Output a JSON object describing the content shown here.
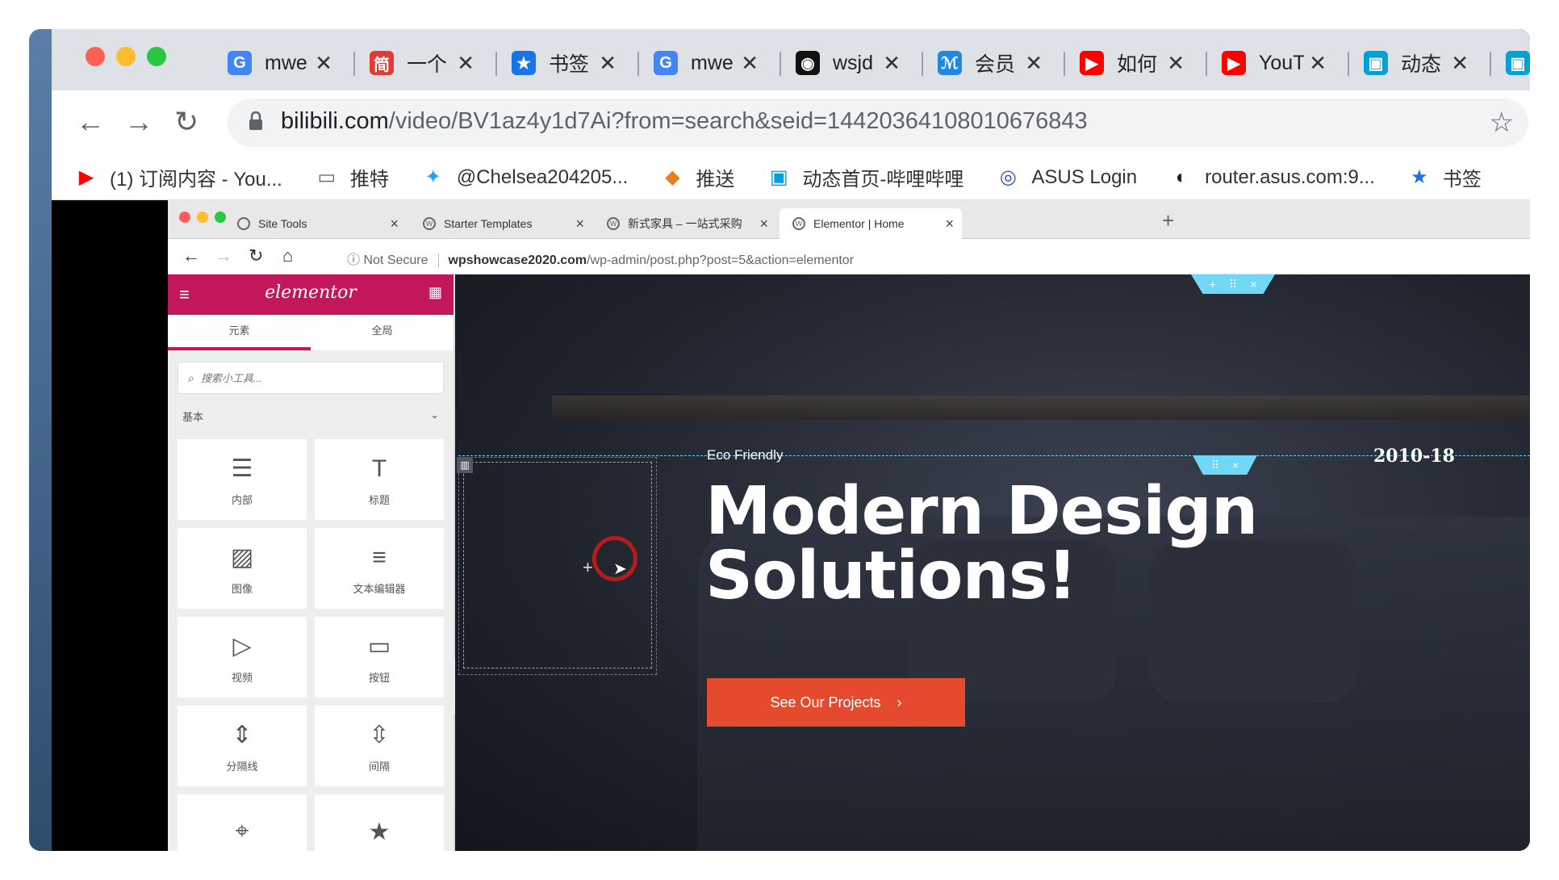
{
  "outer_browser": {
    "tabs": [
      {
        "title": "mwe",
        "icon": "google-icon",
        "color": "#4285f4"
      },
      {
        "title": "一个",
        "icon": "jian-icon",
        "color": "#e53935"
      },
      {
        "title": "书签",
        "icon": "star-icon",
        "color": "#1a73e8"
      },
      {
        "title": "mwe",
        "icon": "google-icon",
        "color": "#4285f4"
      },
      {
        "title": "wsjd",
        "icon": "github-icon",
        "color": "#111111"
      },
      {
        "title": "会员",
        "icon": "app-icon",
        "color": "#1e88e5"
      },
      {
        "title": "如何",
        "icon": "youtube-icon",
        "color": "#ff0000"
      },
      {
        "title": "YouT",
        "icon": "youtube-icon",
        "color": "#ff0000"
      },
      {
        "title": "动态",
        "icon": "bilibili-icon",
        "color": "#00a1d6"
      },
      {
        "title": "",
        "icon": "bilibili-icon",
        "color": "#00a1d6"
      }
    ],
    "url_host": "bilibili.com",
    "url_path": "/video/BV1az4y1d7Ai?from=search&seid=14420364108010676843",
    "bookmarks": [
      {
        "label": "(1) 订阅内容 - You...",
        "icon": "youtube-icon"
      },
      {
        "label": "推特",
        "icon": "folder-icon"
      },
      {
        "label": "@Chelsea204205...",
        "icon": "twitter-icon"
      },
      {
        "label": "推送",
        "icon": "fox-icon"
      },
      {
        "label": "动态首页-哔哩哔哩",
        "icon": "bilibili-icon"
      },
      {
        "label": "ASUS Login",
        "icon": "wifi-icon"
      },
      {
        "label": "router.asus.com:9...",
        "icon": "cat-icon"
      },
      {
        "label": "书签",
        "icon": "star-icon"
      }
    ]
  },
  "inner_browser": {
    "tabs": [
      {
        "title": "Site Tools"
      },
      {
        "title": "Starter Templates"
      },
      {
        "title": "新式家具 – 一站式采购"
      },
      {
        "title": "Elementor | Home"
      }
    ],
    "security": "Not Secure",
    "url_host": "wpshowcase2020.com",
    "url_path": "/wp-admin/post.php?post=5&action=elementor"
  },
  "panel": {
    "logo": "elementor",
    "tab_elements": "元素",
    "tab_global": "全局",
    "search_placeholder": "搜索小工具...",
    "category": "基本",
    "widgets": [
      {
        "label": "内部",
        "icon": "columns-icon"
      },
      {
        "label": "标题",
        "icon": "heading-icon"
      },
      {
        "label": "图像",
        "icon": "image-icon"
      },
      {
        "label": "文本编辑器",
        "icon": "text-editor-icon"
      },
      {
        "label": "视频",
        "icon": "video-icon"
      },
      {
        "label": "按钮",
        "icon": "button-icon"
      },
      {
        "label": "分隔线",
        "icon": "divider-icon"
      },
      {
        "label": "间隔",
        "icon": "spacer-icon"
      },
      {
        "label": "",
        "icon": "map-icon"
      },
      {
        "label": "",
        "icon": "star-icon"
      }
    ]
  },
  "canvas": {
    "eyebrow": "Eco Friendly",
    "year": "2010-18",
    "heading_line1": "Modern Design",
    "heading_line2": "Solutions!",
    "cta": "See Our Projects"
  }
}
